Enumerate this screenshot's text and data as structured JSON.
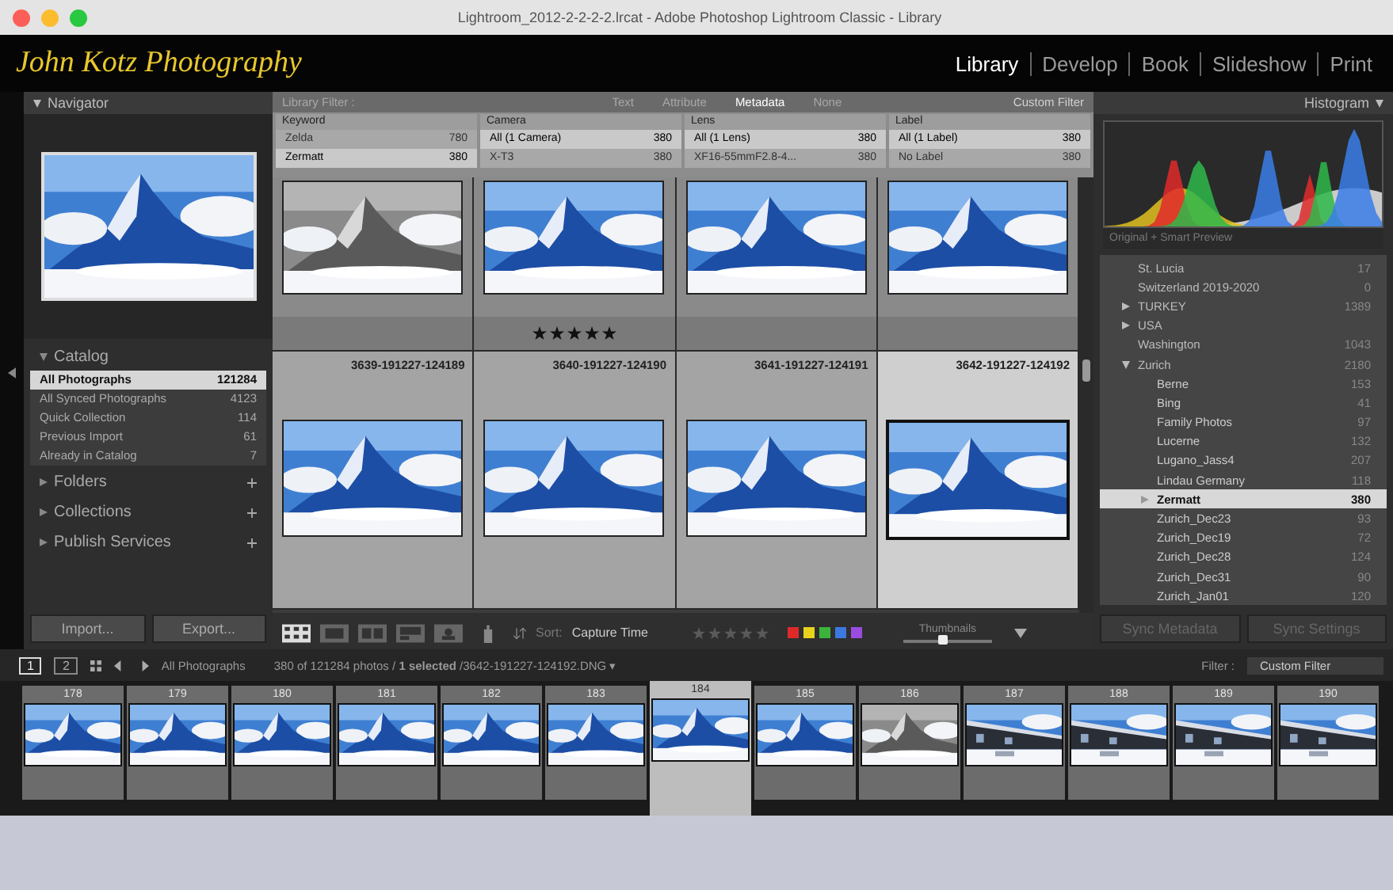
{
  "window": {
    "title": "Lightroom_2012-2-2-2-2.lrcat - Adobe Photoshop Lightroom Classic - Library"
  },
  "identity_plate": "John Kotz Photography",
  "modules": [
    {
      "label": "Library",
      "selected": true
    },
    {
      "label": "Develop",
      "selected": false
    },
    {
      "label": "Book",
      "selected": false
    },
    {
      "label": "Slideshow",
      "selected": false
    },
    {
      "label": "Print",
      "selected": false
    }
  ],
  "navigator": {
    "title": "Navigator"
  },
  "catalog": {
    "title": "Catalog",
    "items": [
      {
        "name": "All Photographs",
        "count": "121284",
        "selected": true
      },
      {
        "name": "All Synced Photographs",
        "count": "4123",
        "selected": false
      },
      {
        "name": "Quick Collection",
        "count": "114",
        "selected": false
      },
      {
        "name": "Previous Import",
        "count": "61",
        "selected": false
      },
      {
        "name": "Already in Catalog",
        "count": "7",
        "selected": false
      }
    ]
  },
  "left_sections": [
    {
      "title": "Folders"
    },
    {
      "title": "Collections"
    },
    {
      "title": "Publish Services"
    }
  ],
  "left_buttons": [
    "Import...",
    "Export..."
  ],
  "library_filter": {
    "title": "Library Filter :",
    "tabs": [
      {
        "label": "Text",
        "selected": false
      },
      {
        "label": "Attribute",
        "selected": false
      },
      {
        "label": "Metadata",
        "selected": true
      },
      {
        "label": "None",
        "selected": false
      }
    ],
    "preset": "Custom Filter",
    "columns": [
      {
        "heading": "Keyword",
        "rows": [
          {
            "name": "Zelda",
            "count": "780",
            "selected": false
          },
          {
            "name": "Zermatt",
            "count": "380",
            "selected": true
          }
        ]
      },
      {
        "heading": "Camera",
        "rows": [
          {
            "name": "All (1 Camera)",
            "count": "380",
            "selected": true
          },
          {
            "name": "X-T3",
            "count": "380",
            "selected": false
          }
        ]
      },
      {
        "heading": "Lens",
        "rows": [
          {
            "name": "All (1 Lens)",
            "count": "380",
            "selected": true
          },
          {
            "name": "XF16-55mmF2.8-4...",
            "count": "380",
            "selected": false
          }
        ]
      },
      {
        "heading": "Label",
        "rows": [
          {
            "name": "All (1 Label)",
            "count": "380",
            "selected": true
          },
          {
            "name": "No Label",
            "count": "380",
            "selected": false
          }
        ]
      }
    ]
  },
  "grid": {
    "top_row": [
      {
        "kind": "gray"
      },
      {
        "stars": 5,
        "kind": "color"
      },
      {
        "kind": "color"
      },
      {
        "kind": "color"
      }
    ],
    "rows": [
      {
        "filename": "3639-191227-124189",
        "selected": false
      },
      {
        "filename": "3640-191227-124190",
        "selected": false
      },
      {
        "filename": "3641-191227-124191",
        "selected": false
      },
      {
        "filename": "3642-191227-124192",
        "selected": true
      }
    ]
  },
  "toolbar": {
    "sort_label": "Sort:",
    "sort_value": "Capture Time",
    "labels": [
      {
        "color": "#e02a2a"
      },
      {
        "color": "#e8d21e"
      },
      {
        "color": "#3cb43c"
      },
      {
        "color": "#3c78e0"
      },
      {
        "color": "#9a4ce0"
      }
    ],
    "thumbnails_label": "Thumbnails",
    "thumbnail_size": {
      "level": 0.45
    }
  },
  "histogram": {
    "title": "Histogram",
    "footer": "Original + Smart Preview"
  },
  "folders": [
    {
      "name": "St. Lucia",
      "count": "17"
    },
    {
      "name": "Switzerland 2019-2020",
      "count": "0"
    },
    {
      "name": "TURKEY",
      "count": "1389",
      "expanded": false,
      "selected": false
    },
    {
      "name": "USA",
      "expanded": false,
      "selected": false
    },
    {
      "name": "Washington",
      "count": "1043",
      "selected": false
    },
    {
      "name": "Zurich",
      "count": "2180",
      "expanded": true,
      "selected": false,
      "children": [
        {
          "name": "Berne",
          "count": "153",
          "selected": false
        },
        {
          "name": "Bing",
          "count": "41",
          "selected": false
        },
        {
          "name": "Family Photos",
          "count": "97",
          "selected": false
        },
        {
          "name": "Lucerne",
          "count": "132",
          "selected": false
        },
        {
          "name": "Lugano_Jass4",
          "count": "207",
          "selected": false
        },
        {
          "name": "Lindau Germany",
          "count": "118",
          "selected": false
        },
        {
          "name": "Zermatt",
          "count": "380",
          "expanded": false,
          "selected": true
        },
        {
          "name": "Zurich_Dec23",
          "count": "93",
          "selected": false
        },
        {
          "name": "Zurich_Dec19",
          "count": "72",
          "selected": false
        },
        {
          "name": "Zurich_Dec28",
          "count": "124",
          "selected": false
        },
        {
          "name": "Zurich_Dec31",
          "count": "90",
          "selected": false
        },
        {
          "name": "Zurich_Jan01",
          "count": "120",
          "selected": false
        }
      ]
    }
  ],
  "right_buttons": [
    "Sync Metadata",
    "Sync Settings"
  ],
  "filmstrip_bar": {
    "pages": [
      {
        "label": "1",
        "selected": true
      },
      {
        "label": "2",
        "selected": false
      }
    ],
    "source": "All Photographs",
    "info": "380 of 121284 photos / **1 selected** /3642-191227-124192.DNG ▾",
    "filter_label": "Filter :",
    "filter_value": "Custom Filter"
  },
  "filmstrip": [
    {
      "number": "178",
      "selected": false,
      "kind": "mountain"
    },
    {
      "number": "179",
      "selected": false,
      "kind": "mountain"
    },
    {
      "number": "180",
      "selected": false,
      "kind": "mountain"
    },
    {
      "number": "181",
      "selected": false,
      "kind": "mountain"
    },
    {
      "number": "182",
      "selected": false,
      "kind": "mountain"
    },
    {
      "number": "183",
      "selected": false,
      "kind": "mountain"
    },
    {
      "number": "184",
      "selected": true,
      "kind": "mountain"
    },
    {
      "number": "185",
      "selected": false,
      "kind": "mountain"
    },
    {
      "number": "186",
      "selected": false,
      "kind": "gray"
    },
    {
      "number": "187",
      "selected": false,
      "kind": "town"
    },
    {
      "number": "188",
      "selected": false,
      "kind": "town"
    },
    {
      "number": "189",
      "selected": false,
      "kind": "town"
    },
    {
      "number": "190",
      "selected": false,
      "kind": "town"
    }
  ]
}
